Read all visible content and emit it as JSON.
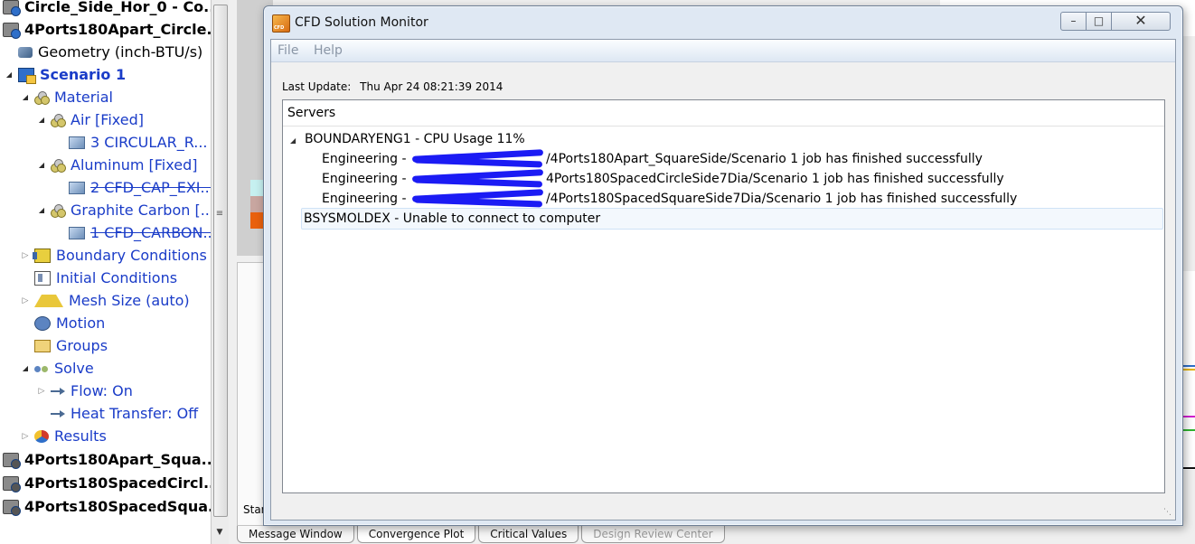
{
  "tree": {
    "items": [
      {
        "label": "Circle_Side_Hor_0 - Co...",
        "icon": "design-study-icon"
      },
      {
        "label": "4Ports180Apart_Circle...",
        "icon": "design-study-icon"
      },
      {
        "label": "Geometry (inch-BTU/s)",
        "icon": "geometry-icon"
      },
      {
        "label": "Scenario 1",
        "icon": "scenario-icon"
      },
      {
        "label": "Material",
        "icon": "material-icon"
      },
      {
        "label": "Air [Fixed]",
        "icon": "material-icon"
      },
      {
        "label": "3 CIRCULAR_R...",
        "icon": "part-icon"
      },
      {
        "label": "Aluminum [Fixed]",
        "icon": "material-icon"
      },
      {
        "label": "2 CFD_CAP_EXI...",
        "icon": "part-icon"
      },
      {
        "label": "Graphite Carbon [...",
        "icon": "material-icon"
      },
      {
        "label": "1 CFD_CARBON...",
        "icon": "part-icon"
      },
      {
        "label": "Boundary Conditions",
        "icon": "boundary-conditions-icon"
      },
      {
        "label": "Initial Conditions",
        "icon": "initial-conditions-icon"
      },
      {
        "label": "Mesh Size (auto)",
        "icon": "mesh-icon"
      },
      {
        "label": "Motion",
        "icon": "motion-icon"
      },
      {
        "label": "Groups",
        "icon": "groups-icon"
      },
      {
        "label": "Solve",
        "icon": "solve-icon"
      },
      {
        "label": "Flow: On",
        "icon": "flow-icon"
      },
      {
        "label": "Heat Transfer: Off",
        "icon": "flow-icon"
      },
      {
        "label": "Results",
        "icon": "results-icon"
      },
      {
        "label": "4Ports180Apart_Squa...",
        "icon": "design-study-icon"
      },
      {
        "label": "4Ports180SpacedCircl...",
        "icon": "design-study-icon"
      },
      {
        "label": "4Ports180SpacedSqua...",
        "icon": "design-study-icon"
      }
    ]
  },
  "dialog": {
    "title": "CFD Solution Monitor",
    "menu": {
      "file": "File",
      "help": "Help"
    },
    "last_update_label": "Last Update:",
    "last_update_value": "Thu Apr 24 08:21:39 2014",
    "servers_header": "Servers",
    "servers": [
      {
        "name": "BOUNDARYENG1 - CPU Usage 11%",
        "jobs": [
          {
            "prefix": "Engineering -",
            "suffix": "/4Ports180Apart_SquareSide/Scenario 1 job has finished successfully"
          },
          {
            "prefix": "Engineering -",
            "suffix": "4Ports180SpacedCircleSide7Dia/Scenario 1 job has finished successfully"
          },
          {
            "prefix": "Engineering -",
            "suffix": "/4Ports180SpacedSquareSide7Dia/Scenario 1 job has finished successfully"
          }
        ]
      },
      {
        "name": "BSYSMOLDEX - Unable to connect to computer"
      }
    ],
    "window_buttons": {
      "minimize": "–",
      "maximize": "□",
      "close": "✕"
    }
  },
  "bottom_tabs": [
    "Message Window",
    "Convergence Plot",
    "Critical Values",
    "Design Review Center"
  ],
  "background": {
    "status_fragment": "Star"
  },
  "colors": {
    "tree_link": "#1a3cc8",
    "redaction": "#1b1bf4",
    "dialog_frame": "#dfe8f3"
  }
}
